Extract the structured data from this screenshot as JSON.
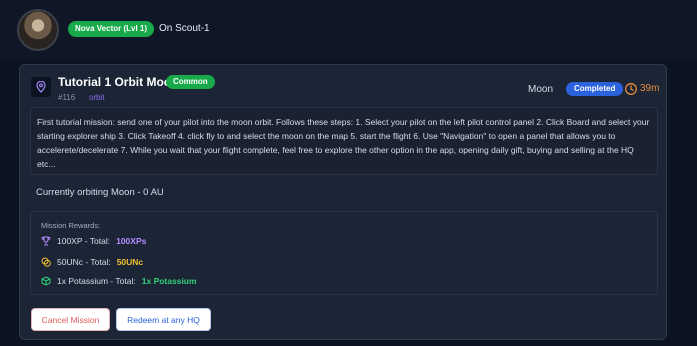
{
  "header": {
    "pilot_name_level": "Nova Vector (Lvl 1)",
    "ship_label": "On Scout-1"
  },
  "mission": {
    "title": "Tutorial 1 Orbit Moon",
    "rarity": "Common",
    "id": "#116",
    "category": "orbit",
    "destination": "Moon",
    "status": "Completed",
    "time_remaining": "39m",
    "description": "First tutorial mission: send one of your pilot into the moon orbit. Follows these steps: 1. Select your pilot on the left pilot control panel 2. Click Board and select your starting explorer ship 3. Click Takeoff 4. click fly to and select the moon on the map 5. start the flight 6. Use \"Navigation\" to open a panel that allows you to accelerete/decelerate 7. While you wait that your flight complete, feel free to explore the other option in the app, opening daily gift, buying and selling at the HQ etc...",
    "orbit_status": "Currently orbiting Moon - 0 AU"
  },
  "rewards": {
    "title": "Mission Rewards:",
    "items": [
      {
        "icon": "trophy-icon",
        "label": "100XP - Total:",
        "total": "100XPs",
        "color": "#b48cff"
      },
      {
        "icon": "coins-icon",
        "label": "50UNc - Total:",
        "total": "50UNc",
        "color": "#f1c232"
      },
      {
        "icon": "cube-icon",
        "label": "1x Potassium - Total:",
        "total": "1x Potassium",
        "color": "#33d17a"
      }
    ]
  },
  "actions": {
    "cancel_label": "Cancel Mission",
    "redeem_label": "Redeem at any HQ"
  },
  "colors": {
    "accent_green": "#18a94b",
    "accent_blue": "#2b62dd",
    "timer_orange": "#e58a3a",
    "danger_red": "#e05a5a"
  }
}
